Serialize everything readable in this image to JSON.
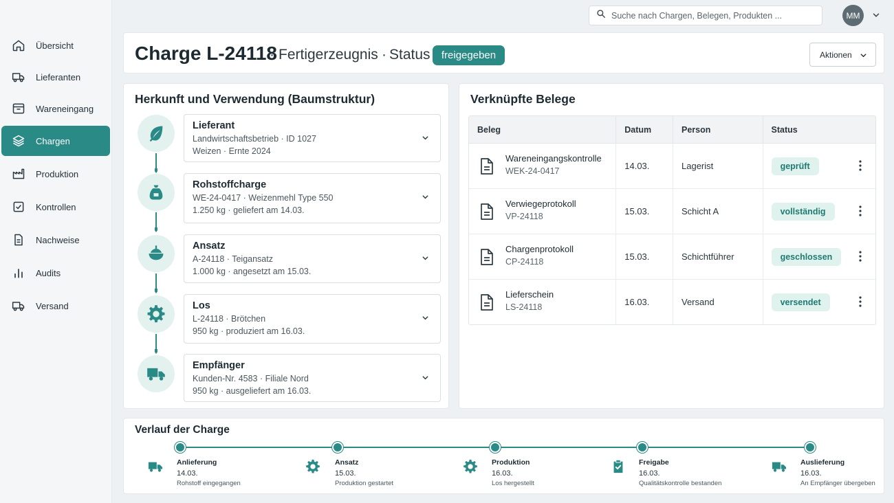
{
  "topbar": {
    "search_placeholder": "Suche nach Chargen, Belegen, Produkten ...",
    "avatar_initials": "MM"
  },
  "sidebar": {
    "items": [
      {
        "label": "Übersicht",
        "icon": "home-icon",
        "active": false
      },
      {
        "label": "Lieferanten",
        "icon": "truck-icon",
        "active": false
      },
      {
        "label": "Wareneingang",
        "icon": "inbox-icon",
        "active": false
      },
      {
        "label": "Chargen",
        "icon": "layers-icon",
        "active": true
      },
      {
        "label": "Produktion",
        "icon": "factory-icon",
        "active": false
      },
      {
        "label": "Kontrollen",
        "icon": "checkbox-icon",
        "active": false
      },
      {
        "label": "Nachweise",
        "icon": "document-icon",
        "active": false
      },
      {
        "label": "Audits",
        "icon": "bar-chart-icon",
        "active": false
      },
      {
        "label": "Versand",
        "icon": "truck-icon",
        "active": false
      }
    ]
  },
  "header": {
    "title": "Charge L-24118",
    "separator": "·",
    "subtitle": "Fertigerzeugnis",
    "status_label": "Status",
    "status_value": "freigegeben",
    "actions_label": "Aktionen"
  },
  "tree": {
    "title": "Herkunft und Verwendung (Baumstruktur)",
    "nodes": [
      {
        "title": "Lieferant",
        "line1": "Landwirtschaftsbetrieb · ID  1027",
        "line2": "Weizen · Ernte 2024",
        "icon": "leaf-icon"
      },
      {
        "title": "Rohstoffcharge",
        "line1": "WE-24-0417  ·  Weizenmehl Type 550",
        "line2": "1.250 kg  · geliefert am 14.03.",
        "icon": "sack-icon"
      },
      {
        "title": "Ansatz",
        "line1": "A-24118  ·  Teigansatz",
        "line2": "1.000 kg  · angesetzt am 15.03.",
        "icon": "bowl-icon"
      },
      {
        "title": "Los",
        "line1": "L-24118  ·  Brötchen",
        "line2": "950 kg  · produziert am 16.03.",
        "icon": "gear-icon"
      },
      {
        "title": "Empfänger",
        "line1": "Kunden-Nr.  4583  ·  Filiale Nord",
        "line2": "950 kg  · ausgeliefert am 16.03.",
        "icon": "truck-icon"
      }
    ]
  },
  "documents": {
    "title": "Verknüpfte Belege",
    "columns": [
      "Beleg",
      "Datum",
      "Person",
      "Status"
    ],
    "rows": [
      {
        "name": "Wareneingangskontrolle",
        "id": "WEK-24-0417",
        "date": "14.03.",
        "person": "Lagerist",
        "status": "geprüft"
      },
      {
        "name": "Verwiegeprotokoll",
        "id": "VP-24118",
        "date": "15.03.",
        "person": "Schicht A",
        "status": "vollständig"
      },
      {
        "name": "Chargenprotokoll",
        "id": "CP-24118",
        "date": "15.03.",
        "person": "Schichtführer",
        "status": "geschlossen"
      },
      {
        "name": "Lieferschein",
        "id": "LS-24118",
        "date": "16.03.",
        "person": "Versand",
        "status": "versendet"
      }
    ]
  },
  "timeline": {
    "title": "Verlauf der Charge",
    "steps": [
      {
        "label": "Anlieferung",
        "date": "14.03.",
        "desc": "Rohstoff eingegangen",
        "icon": "truck-icon"
      },
      {
        "label": "Ansatz",
        "date": "15.03.",
        "desc": "Produktion gestartet",
        "icon": "gear-icon"
      },
      {
        "label": "Produktion",
        "date": "16.03.",
        "desc": "Los hergestellt",
        "icon": "gear-icon"
      },
      {
        "label": "Freigabe",
        "date": "16.03.",
        "desc": "Qualitätskontrolle bestanden",
        "icon": "clipboard-check-icon"
      },
      {
        "label": "Auslieferung",
        "date": "16.03.",
        "desc": "An Empfänger übergeben",
        "icon": "truck-icon"
      }
    ]
  },
  "colors": {
    "accent": "#2a8a86",
    "accent_light": "#e3f1ef",
    "status_pill_bg": "#dff2ee",
    "status_pill_text": "#1f7a72"
  }
}
